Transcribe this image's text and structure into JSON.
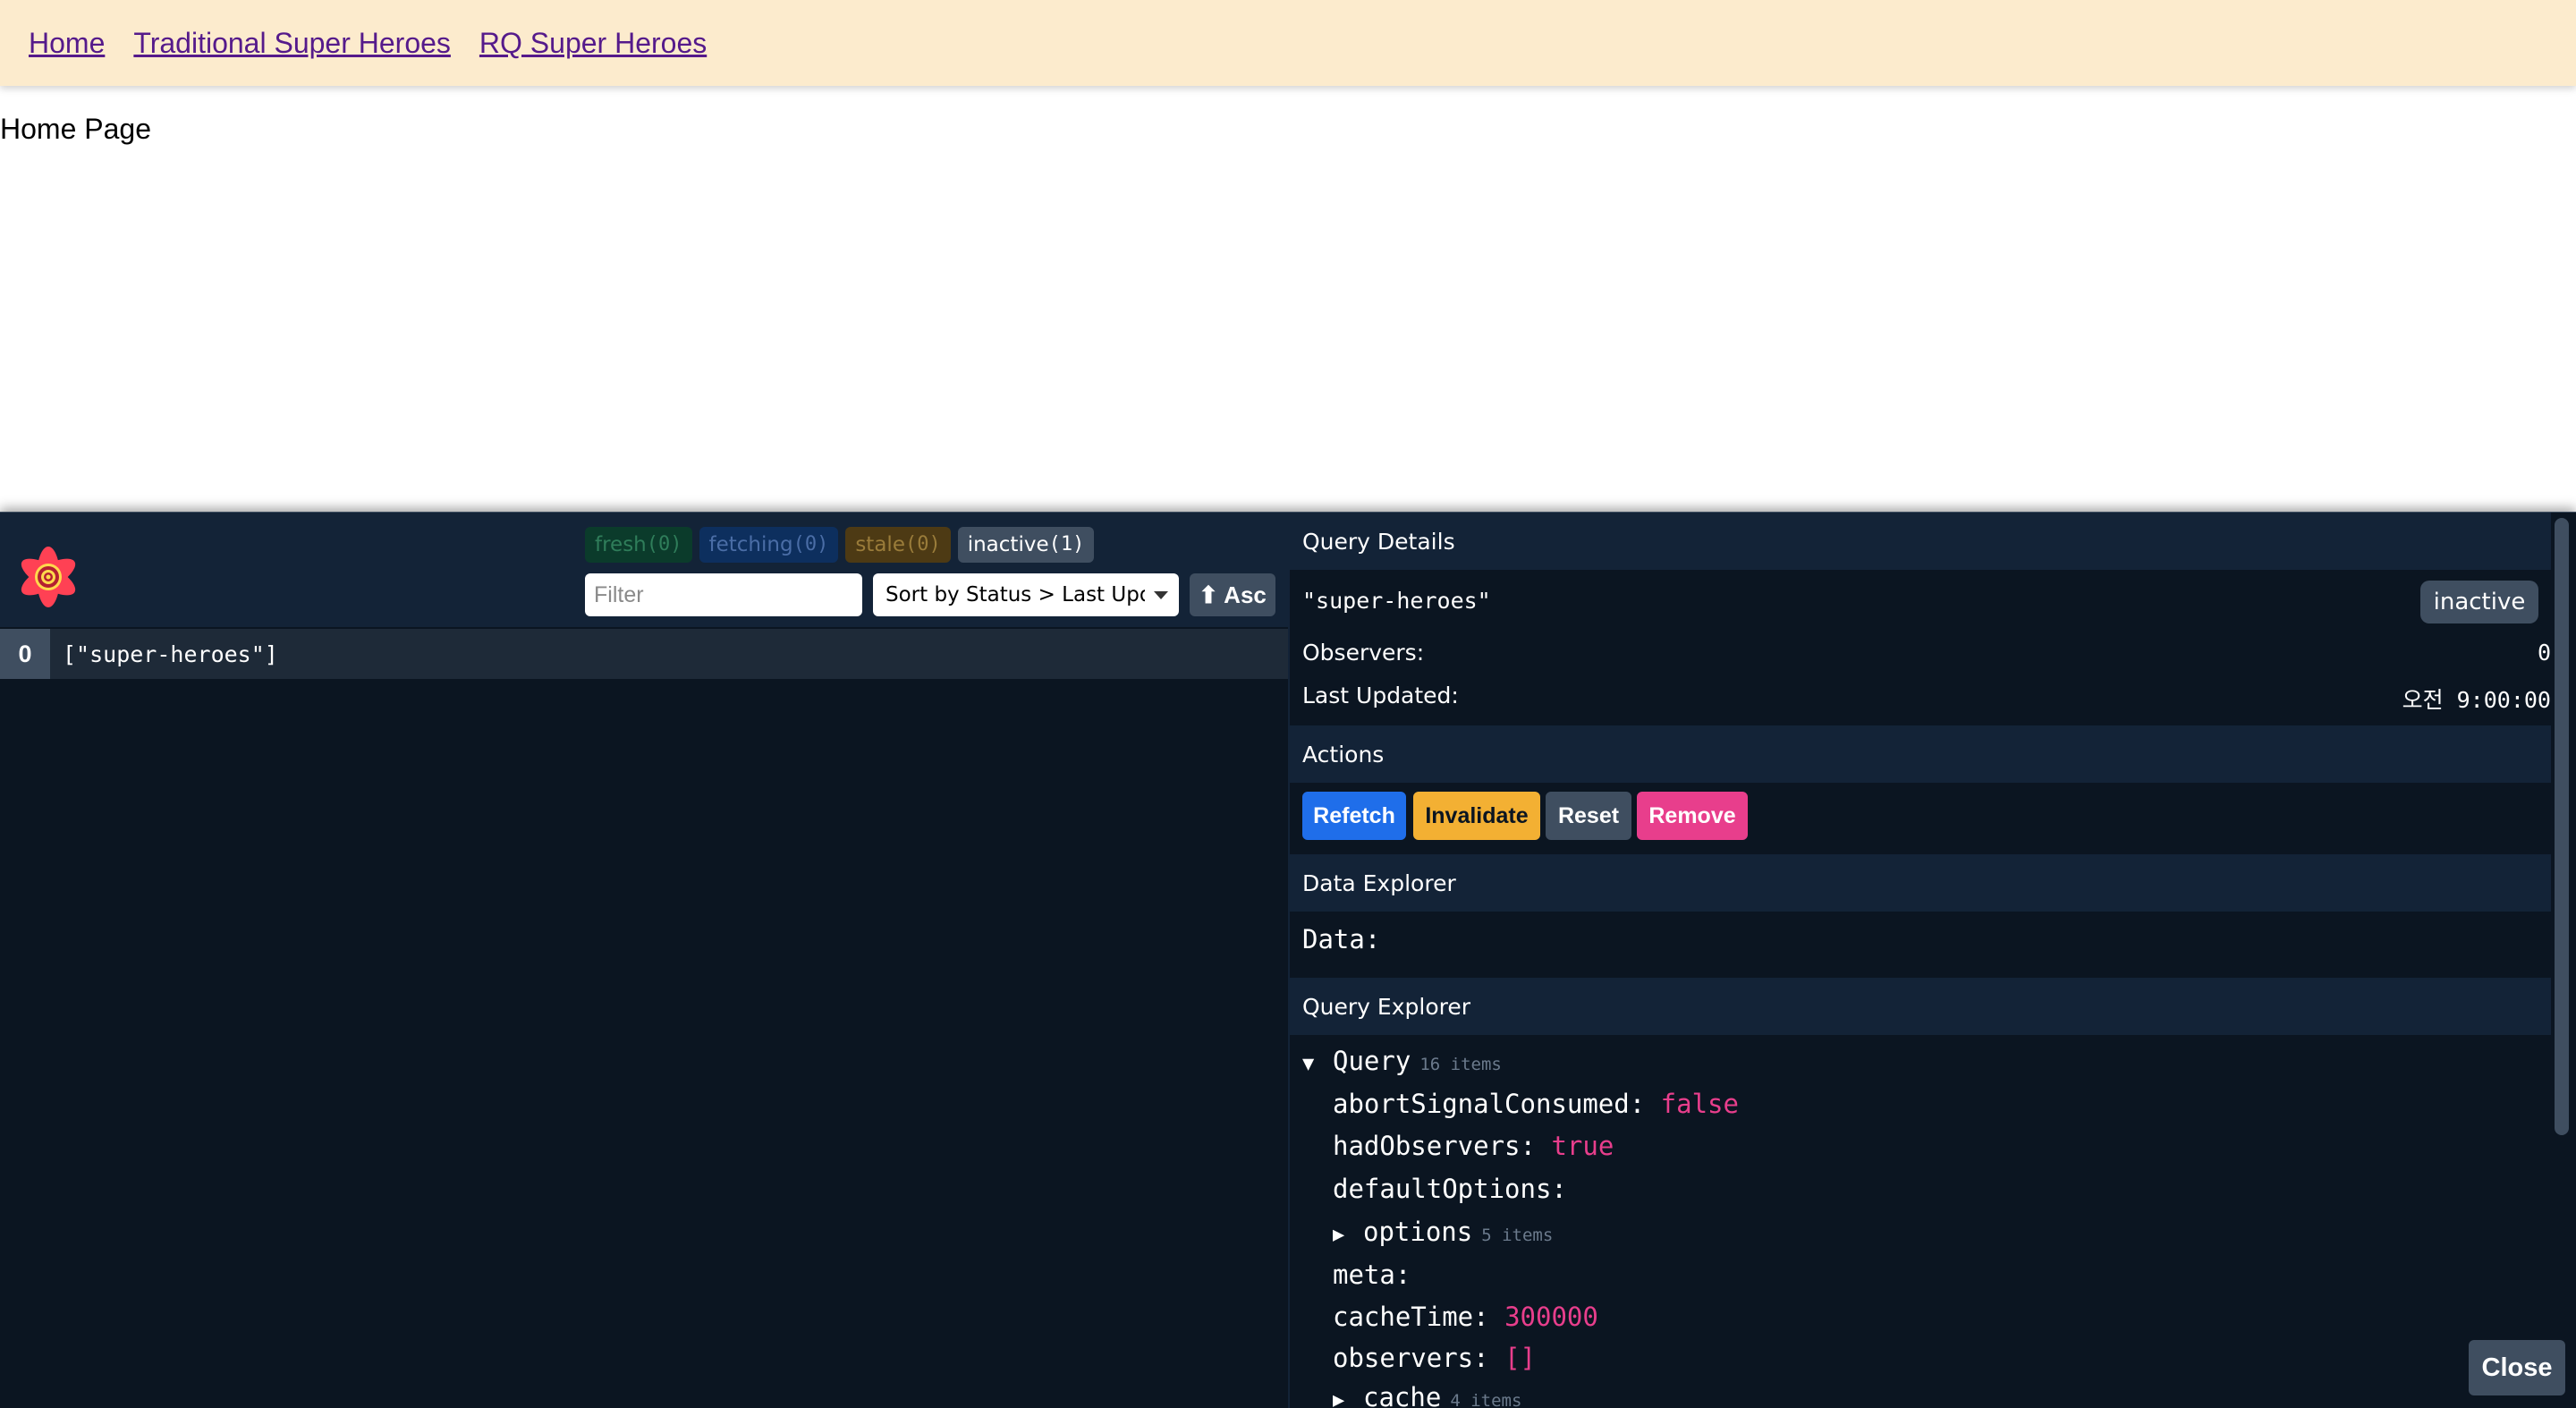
{
  "nav": {
    "links": [
      "Home",
      "Traditional Super Heroes",
      "RQ Super Heroes"
    ]
  },
  "page": {
    "title": "Home Page"
  },
  "devtools": {
    "filters": {
      "fresh": {
        "label": "fresh",
        "count": "(0)"
      },
      "fetching": {
        "label": "fetching",
        "count": "(0)"
      },
      "stale": {
        "label": "stale",
        "count": "(0)"
      },
      "inactive": {
        "label": "inactive",
        "count": "(1)"
      }
    },
    "filter_placeholder": "Filter",
    "sort_label": "Sort by Status > Last Updated",
    "asc_label": "⬆ Asc",
    "queries": [
      {
        "count": "0",
        "key": "[\"super-heroes\"]"
      }
    ],
    "details": {
      "header": "Query Details",
      "key": "\"super-heroes\"",
      "status": "inactive",
      "observers_label": "Observers:",
      "observers_value": "0",
      "last_updated_label": "Last Updated:",
      "last_updated_value": "오전 9:00:00"
    },
    "actions": {
      "header": "Actions",
      "refetch": "Refetch",
      "invalidate": "Invalidate",
      "reset": "Reset",
      "remove": "Remove"
    },
    "data_explorer": {
      "header": "Data Explorer",
      "label": "Data:"
    },
    "query_explorer": {
      "header": "Query Explorer",
      "root_label": "Query",
      "root_meta": "16 items",
      "rows": [
        {
          "key": "abortSignalConsumed:",
          "value": "false"
        },
        {
          "key": "hadObservers:",
          "value": "true"
        },
        {
          "key": "defaultOptions:",
          "value": ""
        },
        {
          "key": "options",
          "meta": "5 items"
        },
        {
          "key": "meta:",
          "value": ""
        },
        {
          "key": "cacheTime:",
          "value": "300000"
        },
        {
          "key": "observers:",
          "value": "[]"
        },
        {
          "key": "cache",
          "meta": "4 items"
        }
      ]
    },
    "close_label": "Close",
    "colors": {
      "panel_bg": "#0b1521",
      "header_bg": "#132337",
      "accent_pink": "#e83e8c",
      "refetch_blue": "#1f6eea",
      "invalidate_yellow": "#f3b033",
      "gray": "#3f4e60"
    }
  }
}
